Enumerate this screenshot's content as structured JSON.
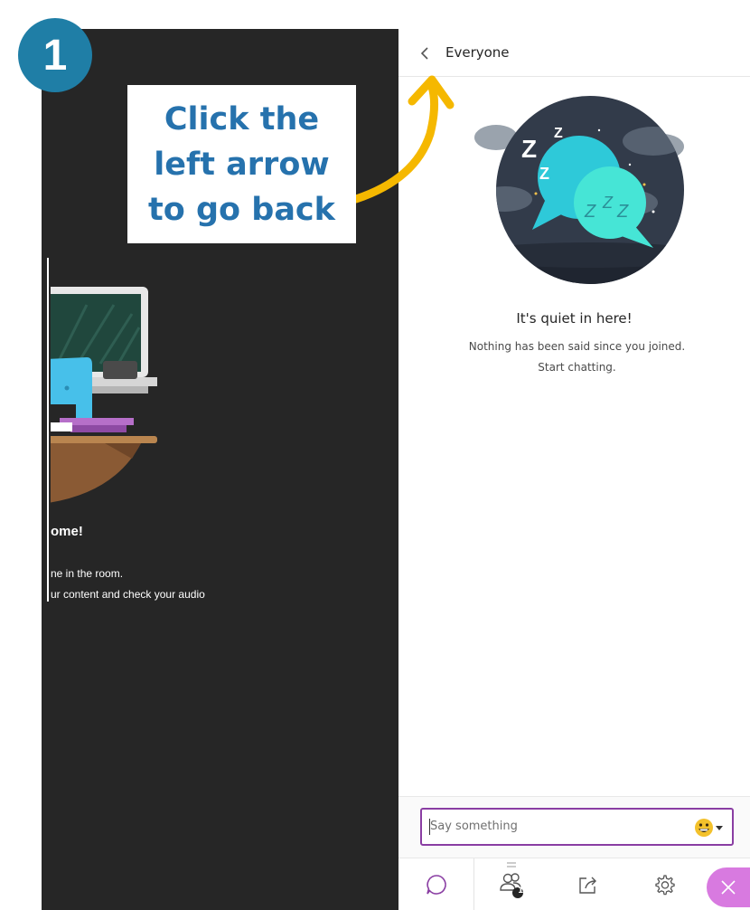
{
  "step_badge": {
    "number": "1"
  },
  "callout": {
    "lines": [
      "Click the",
      "left arrow",
      "to go back"
    ],
    "color": "#2672ad",
    "arrow_color": "#f5b800"
  },
  "stage": {
    "welcome_title": "ome!",
    "welcome_lines": [
      "ne in the room.",
      "ur content and check your audio"
    ]
  },
  "chat": {
    "header": {
      "back_icon": "chevron-left-icon",
      "title": "Everyone"
    },
    "empty_state": {
      "illustration": "sleeping-chat-bubbles",
      "title": "It's quiet in here!",
      "lines": [
        "Nothing has been said since you joined.",
        "Start chatting."
      ]
    },
    "composer": {
      "placeholder": "Say something",
      "emoji_icon": "grinning-face-icon"
    },
    "nav": {
      "tabs": [
        {
          "name": "chat",
          "icon": "chat-bubble-icon",
          "active": true
        },
        {
          "name": "attendees",
          "icon": "people-icon",
          "badge": "1"
        },
        {
          "name": "share-content",
          "icon": "share-icon"
        },
        {
          "name": "settings",
          "icon": "gear-icon"
        }
      ],
      "close_icon": "close-icon"
    },
    "accent_color": "#8a3ea3"
  }
}
